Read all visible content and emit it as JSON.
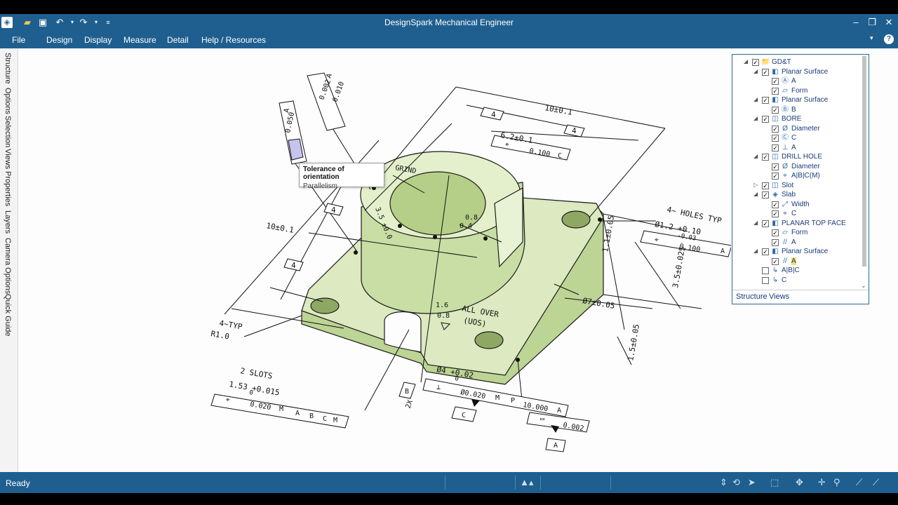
{
  "app": {
    "title": "DesignSpark Mechanical Engineer"
  },
  "menu": [
    "File",
    "Design",
    "Display",
    "Measure",
    "Detail",
    "Help / Resources"
  ],
  "left_tabs": [
    "Structure",
    "Options",
    "Selection",
    "Views",
    "Properties",
    "Layers",
    "Camera Options",
    "Quick Guide"
  ],
  "tooltip": {
    "title": "Tolerance of orientation",
    "subtitle": "Parallelism"
  },
  "tree": {
    "rows": [
      {
        "label": "GD&T",
        "toggle": "◢",
        "checked": true,
        "icon": "folder-icon",
        "glyph": "📁",
        "indent": 0
      },
      {
        "label": "Planar Surface",
        "toggle": "◢",
        "checked": true,
        "icon": "surface-icon",
        "glyph": "◧",
        "indent": 1
      },
      {
        "label": "A",
        "toggle": "",
        "checked": true,
        "icon": "datum-icon",
        "glyph": "Ⓐ",
        "indent": 2
      },
      {
        "label": "Form",
        "toggle": "",
        "checked": true,
        "icon": "flatness-icon",
        "glyph": "▱",
        "indent": 2
      },
      {
        "label": "Planar Surface",
        "toggle": "◢",
        "checked": true,
        "icon": "surface-icon",
        "glyph": "◧",
        "indent": 1
      },
      {
        "label": "B",
        "toggle": "",
        "checked": true,
        "icon": "datum-icon",
        "glyph": "Ⓑ",
        "indent": 2
      },
      {
        "label": "BORE",
        "toggle": "◢",
        "checked": true,
        "icon": "bore-icon",
        "glyph": "◫",
        "indent": 1
      },
      {
        "label": "Diameter",
        "toggle": "",
        "checked": true,
        "icon": "diameter-icon",
        "glyph": "Ø",
        "indent": 2
      },
      {
        "label": "C",
        "toggle": "",
        "checked": true,
        "icon": "datum-icon",
        "glyph": "Ⓒ",
        "indent": 2
      },
      {
        "label": "A",
        "toggle": "",
        "checked": true,
        "icon": "perpendicularity-icon",
        "glyph": "⊥",
        "indent": 2
      },
      {
        "label": "DRILL HOLE",
        "toggle": "◢",
        "checked": true,
        "icon": "hole-icon",
        "glyph": "◫",
        "indent": 1
      },
      {
        "label": "Diameter",
        "toggle": "",
        "checked": true,
        "icon": "diameter-icon",
        "glyph": "Ø",
        "indent": 2
      },
      {
        "label": "A|B|C(M)",
        "toggle": "",
        "checked": true,
        "icon": "position-icon",
        "glyph": "⌖",
        "indent": 2
      },
      {
        "label": "Slot",
        "toggle": "▷",
        "checked": true,
        "icon": "slot-icon",
        "glyph": "◫",
        "indent": 1
      },
      {
        "label": "Slab",
        "toggle": "◢",
        "checked": true,
        "icon": "slab-icon",
        "glyph": "◈",
        "indent": 1
      },
      {
        "label": "Width",
        "toggle": "",
        "checked": true,
        "icon": "width-icon",
        "glyph": "⤢",
        "indent": 2
      },
      {
        "label": "C",
        "toggle": "",
        "checked": true,
        "icon": "position-icon",
        "glyph": "⌖",
        "indent": 2
      },
      {
        "label": "PLANAR TOP FACE",
        "toggle": "◢",
        "checked": true,
        "icon": "surface-icon",
        "glyph": "◧",
        "indent": 1
      },
      {
        "label": "Form",
        "toggle": "",
        "checked": true,
        "icon": "flatness-icon",
        "glyph": "▱",
        "indent": 2
      },
      {
        "label": "A",
        "toggle": "",
        "checked": true,
        "icon": "parallelism-icon",
        "glyph": "//",
        "indent": 2
      },
      {
        "label": "Planar Surface",
        "toggle": "◢",
        "checked": true,
        "icon": "surface-icon",
        "glyph": "◧",
        "indent": 1
      },
      {
        "label": "A",
        "toggle": "",
        "checked": true,
        "icon": "parallelism-icon",
        "glyph": "//",
        "indent": 2,
        "highlight": true
      },
      {
        "label": "A|B|C",
        "toggle": "",
        "checked": false,
        "icon": "datum-system-icon",
        "glyph": "↳",
        "indent": 1
      },
      {
        "label": "C",
        "toggle": "",
        "checked": false,
        "icon": "datum-system-icon",
        "glyph": "↳",
        "indent": 1
      }
    ],
    "tabs": [
      "Structure",
      "Views"
    ]
  },
  "drawing": {
    "dims": {
      "d10_top": "10±0.1",
      "d10_left": "10±0.1",
      "d4_a": "4",
      "d4_b": "4",
      "d4_c": "4",
      "d4_d": "4",
      "d62": "6.2±0.1",
      "holes": "4~ HOLES TYP",
      "hole_dia": "Ø1.2 +0.10",
      "hole_tol": "-0.03",
      "d35": "3.5±0.025",
      "d7": "Ø7±0.05",
      "d15": "1.5±0.05",
      "d105": "1.1±0.05",
      "slots": "2 SLOTS",
      "slot_dim": "1.53 +0.015",
      "slot_zero": "0",
      "typ": "4~TYP",
      "r10": "R1.0",
      "d4_bore": "Ø4 +0.02",
      "d4_bore_zero": "0",
      "grind": "GRIND",
      "r08": "0.8",
      "r04": "0.4",
      "s16": "1.6",
      "s08": "0.8",
      "allover": "ALL OVER",
      "uos": "(UOS)",
      "d35b": "3.5 ±0.0",
      "twox": "2X"
    },
    "fcf": {
      "pos_tol": "0.100",
      "pos_ref": "C",
      "hole_pos_tol": "0.100",
      "hole_ref": "A",
      "flat_tol": "0.050",
      "flat_ref": "A",
      "par1": "0.002",
      "par2": "0.010",
      "par_ref": "A",
      "slot_tol": "0.020",
      "slot_m": "M",
      "slot_a": "A",
      "slot_b": "B",
      "slot_c": "C",
      "slot_cm": "M",
      "perp_tol": "Ø0.020",
      "perp_m": "M",
      "perp_p": "P",
      "perp_len": "10.000",
      "perp_ref": "A",
      "flat2_tol": "0.002",
      "datum_c": "C",
      "datum_a": "A",
      "datum_b": "B"
    }
  },
  "status": {
    "text": "Ready"
  },
  "colors": {
    "chrome": "#1f5f8f",
    "part_fill": "#dbe9bf",
    "part_edge": "#1b1b1b",
    "highlight": "#c7c3ef"
  }
}
